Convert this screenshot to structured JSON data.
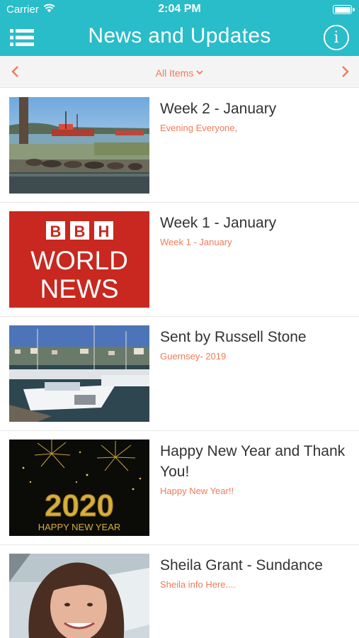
{
  "status_bar": {
    "carrier": "Carrier",
    "time": "2:04 PM"
  },
  "header": {
    "title": "News and Updates"
  },
  "filter": {
    "label": "All Items"
  },
  "colors": {
    "header_bg": "#29bcc9",
    "accent": "#f07a5a"
  },
  "items": [
    {
      "title": "Week 2 - January",
      "subtitle": "Evening Everyone,",
      "image": "harbour-seals-photo"
    },
    {
      "title": "Week 1 - January",
      "subtitle": "Week 1 - January",
      "image": "bbh-world-news-logo",
      "logo_letters": [
        "B",
        "B",
        "H"
      ],
      "logo_line1": "WORLD",
      "logo_line2": "NEWS"
    },
    {
      "title": "Sent by Russell Stone",
      "subtitle": "Guernsey- 2019",
      "image": "marina-boats-photo"
    },
    {
      "title": "Happy New Year and Thank You!",
      "subtitle": "Happy New Year!!",
      "image": "fireworks-2020-image",
      "year_text": "2020",
      "greeting_text": "HAPPY NEW YEAR"
    },
    {
      "title": "Sheila Grant - Sundance",
      "subtitle": "Sheila info Here....",
      "image": "portrait-photo"
    }
  ]
}
